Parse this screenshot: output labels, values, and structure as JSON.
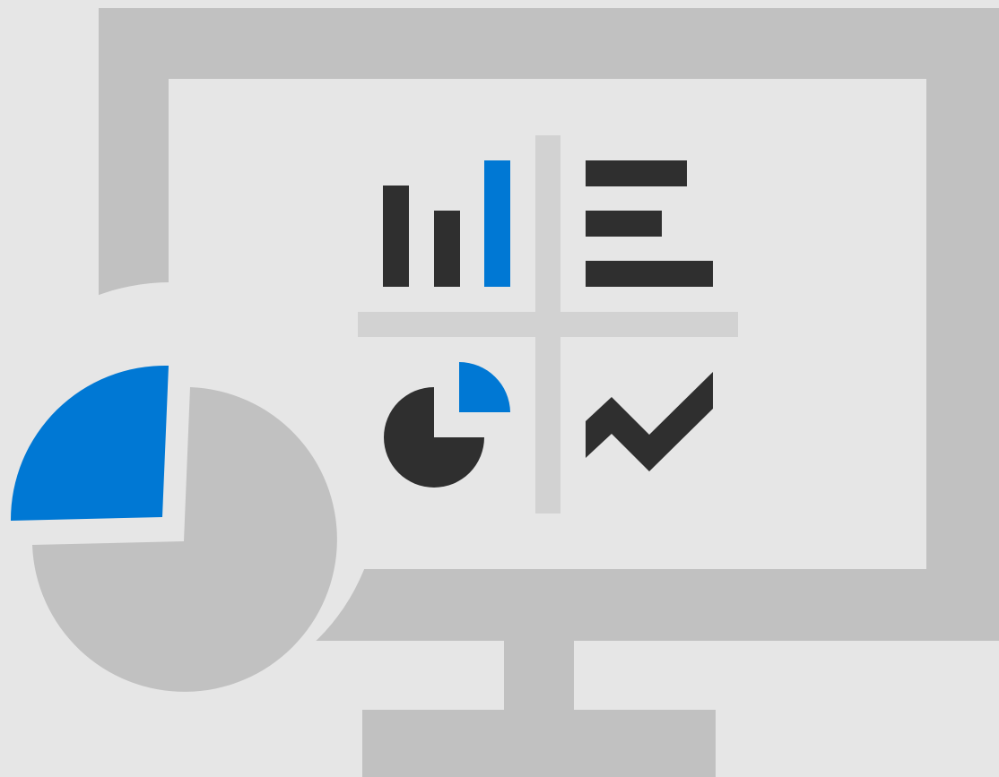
{
  "illustration": {
    "subject": "dashboard-analytics-icon",
    "palette": {
      "background": "#e6e6e6",
      "frame": "#c1c1c1",
      "screen": "#e6e6e6",
      "divider": "#d2d2d2",
      "dark": "#2f2f2f",
      "accent": "#0078d4"
    },
    "icons": [
      "monitor-icon",
      "pie-chart-icon",
      "bar-chart-icon",
      "horizontal-bar-chart-icon",
      "small-pie-chart-icon",
      "line-chart-icon"
    ]
  }
}
